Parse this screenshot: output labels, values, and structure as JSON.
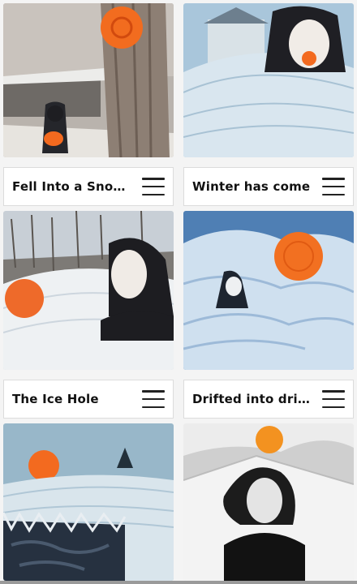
{
  "cards": [
    {
      "title": "",
      "art": "woman-under-tree-with-orange-flower"
    },
    {
      "title": "",
      "art": "woman-in-snow-with-orange-ball"
    },
    {
      "title": "Fell Into a Snow...",
      "art": "woman-lying-in-snow-drift"
    },
    {
      "title": "Winter has come",
      "art": "figure-in-snow-with-orange-sun"
    },
    {
      "title": "The Ice Hole",
      "art": "frozen-river-with-orange-sun"
    },
    {
      "title": "Drifted into drift...",
      "art": "woman-with-orange-sun-monochrome"
    }
  ],
  "icons": {
    "menu": "hamburger-menu-icon"
  },
  "colors": {
    "accent": "#f36a1f",
    "snow": "#e9eef2",
    "ink": "#111111"
  }
}
